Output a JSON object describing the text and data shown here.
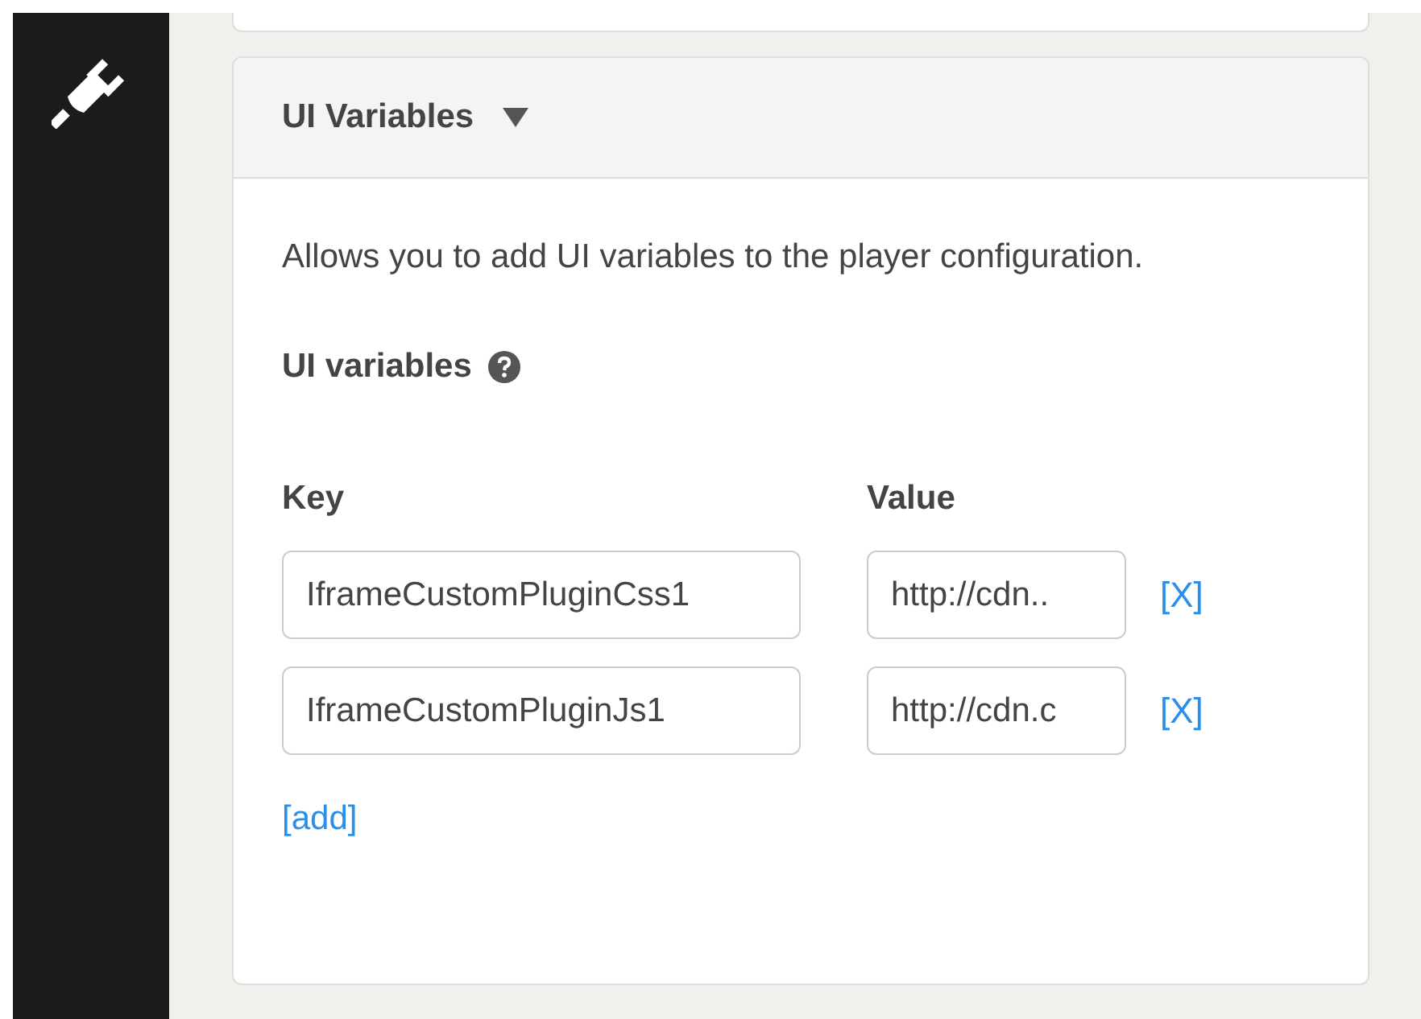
{
  "panel": {
    "title": "UI Variables",
    "expanded": true,
    "description": "Allows you to add UI variables to the player configuration.",
    "field_label": "UI variables",
    "columns": [
      "Key",
      "Value"
    ],
    "rows": [
      {
        "key": "IframeCustomPluginCss1",
        "value": "http://cdn..",
        "remove": "[X]"
      },
      {
        "key": "IframeCustomPluginJs1",
        "value": "http://cdn.c",
        "remove": "[X]"
      }
    ],
    "add_link": "[add]"
  }
}
